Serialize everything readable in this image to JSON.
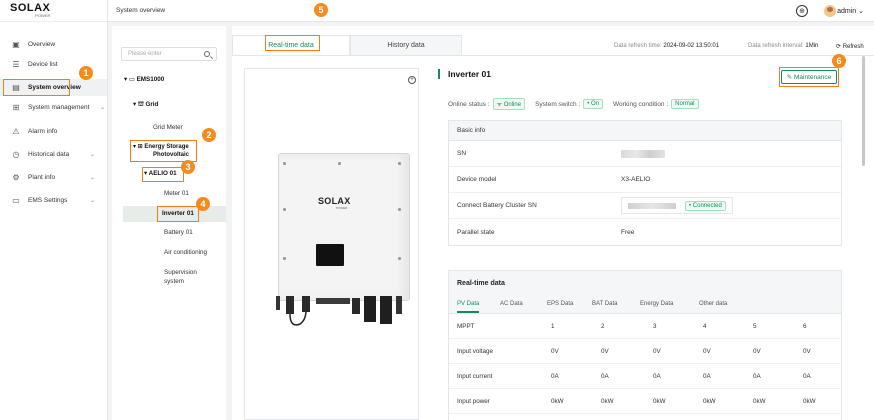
{
  "logo": {
    "main": "SOLAX",
    "sub": "POWER"
  },
  "sidebar": {
    "items": [
      {
        "label": "Overview",
        "icon": "overview-icon",
        "glyph": "▣",
        "chevron": ""
      },
      {
        "label": "Device list",
        "icon": "device-list-icon",
        "glyph": "☰",
        "chevron": ""
      },
      {
        "label": "System overview",
        "icon": "system-overview-icon",
        "glyph": "▤",
        "chevron": ""
      },
      {
        "label": "System management",
        "icon": "system-management-icon",
        "glyph": "⊞",
        "chevron": "⌄"
      },
      {
        "label": "Alarm info",
        "icon": "alarm-icon",
        "glyph": "⚠",
        "chevron": ""
      },
      {
        "label": "Historical data",
        "icon": "history-icon",
        "glyph": "◷",
        "chevron": "⌄"
      },
      {
        "label": "Plant info",
        "icon": "plant-info-icon",
        "glyph": "⚙",
        "chevron": "⌄"
      },
      {
        "label": "EMS Settings",
        "icon": "ems-settings-icon",
        "glyph": "▭",
        "chevron": "⌄"
      }
    ]
  },
  "topbar": {
    "title": "System overview",
    "user": "admin ⌄"
  },
  "tree": {
    "search_placeholder": "Please enter",
    "nodes": {
      "ems": "▾ ▭ EMS1000",
      "grid": "▾ ⛫ Grid",
      "grid_meter": "Grid Meter",
      "es_line1": "▾ ⊞ Energy Storage",
      "es_line2": "Photovoltaic",
      "aelio": "▾ AELIO 01",
      "meter": "Meter 01",
      "inverter": "Inverter 01",
      "battery": "Battery 01",
      "air": "Air conditioning",
      "super1": "Supervision",
      "super2": "system"
    }
  },
  "tabs": {
    "realtime": "Real-time data",
    "history": "History data"
  },
  "refresh": {
    "time_label": "Data refresh time:",
    "time_value": "2024-09-02 13:50:01",
    "interval_label": "Data refresh interval:",
    "interval_value": "1Min",
    "button": "⟳ Refresh"
  },
  "device": {
    "title": "Inverter 01",
    "maintenance": "✎ Maintenance",
    "online_label": "Online status :",
    "online_value": "ᯤ Online",
    "switch_label": "System switch :",
    "switch_value": "• On",
    "condition_label": "Working condition :",
    "condition_value": "Normal"
  },
  "basic_info": {
    "header": "Basic info",
    "sn_label": "SN",
    "model_label": "Device model",
    "model_value": "X3-AELIO",
    "battery_label": "Connect Battery Cluster SN",
    "battery_status": "• Connected",
    "parallel_label": "Parallel state",
    "parallel_value": "Free"
  },
  "realtime": {
    "header": "Real-time data",
    "tabs": [
      "PV Data",
      "AC Data",
      "EPS Data",
      "BAT Data",
      "Energy Data",
      "Other data"
    ],
    "rows": [
      {
        "label": "MPPT",
        "values": [
          "1",
          "2",
          "3",
          "4",
          "5",
          "6"
        ]
      },
      {
        "label": "Input voltage",
        "values": [
          "0V",
          "0V",
          "0V",
          "0V",
          "0V",
          "0V"
        ]
      },
      {
        "label": "Input current",
        "values": [
          "0A",
          "0A",
          "0A",
          "0A",
          "0A",
          "0A"
        ]
      },
      {
        "label": "Input power",
        "values": [
          "0kW",
          "0kW",
          "0kW",
          "0kW",
          "0kW",
          "0kW"
        ]
      }
    ]
  },
  "markers": [
    "1",
    "2",
    "3",
    "4",
    "5",
    "6"
  ],
  "colors": {
    "accent": "#1a8a5a",
    "marker": "#f58a1f"
  }
}
